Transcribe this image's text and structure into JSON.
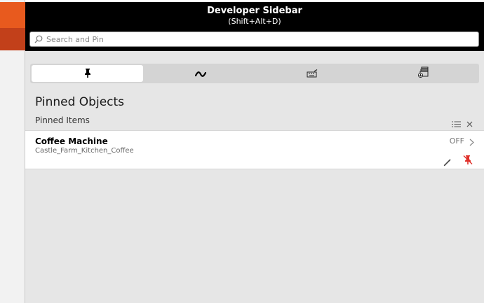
{
  "header": {
    "title": "Developer Sidebar",
    "shortcut": "(Shift+Alt+D)"
  },
  "search": {
    "placeholder": "Search and Pin",
    "value": ""
  },
  "tabs": [
    {
      "icon": "pin-icon",
      "active": true
    },
    {
      "icon": "wave-icon",
      "active": false
    },
    {
      "icon": "keyboard-icon",
      "active": false
    },
    {
      "icon": "add-stack-icon",
      "active": false
    }
  ],
  "section": {
    "title": "Pinned Objects",
    "subheader": "Pinned Items"
  },
  "items": [
    {
      "name": "Coffee Machine",
      "path": "Castle_Farm_Kitchen_Coffee",
      "state": "OFF"
    }
  ],
  "colors": {
    "accent_orange": "#e85a1e",
    "accent_dark_orange": "#c2401a",
    "unpin_red": "#e0302a"
  }
}
